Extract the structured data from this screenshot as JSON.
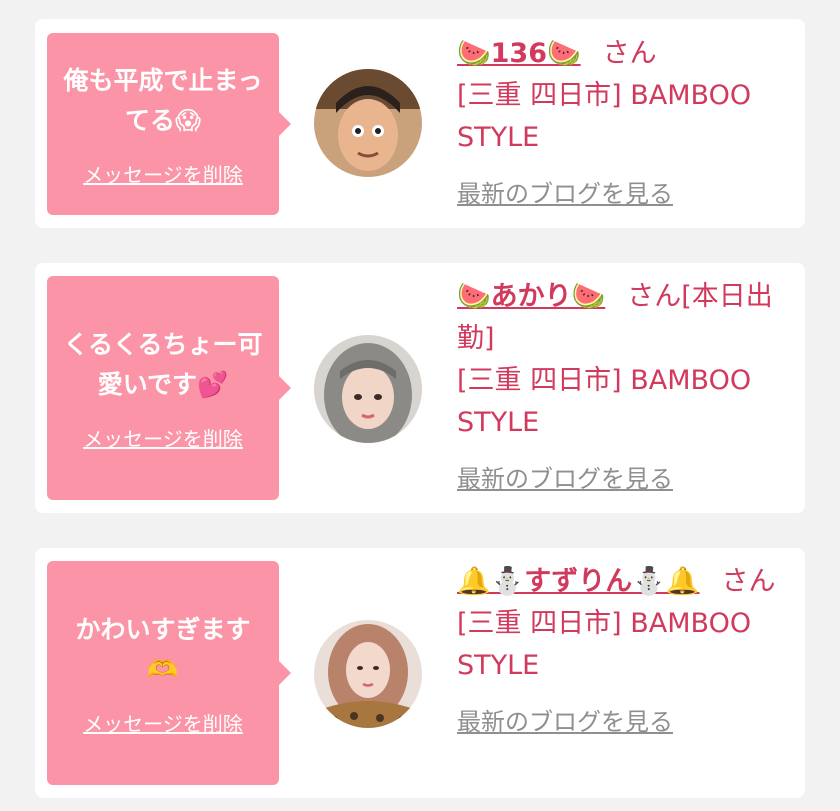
{
  "colors": {
    "background": "#f2f2f2",
    "card": "#ffffff",
    "bubble": "#fb94a6",
    "accent_text": "#d13a5c",
    "muted_link": "#8f8f8f"
  },
  "cards": [
    {
      "message": "俺も平成で止まってる😱",
      "delete_label": "メッセージを削除",
      "name": "🍉136🍉",
      "honorific": "さん",
      "shop": "[三重 四日市] BAMBOO STYLE",
      "blog_label": "最新のブログを見る",
      "avatar_icon": "user-avatar-photo"
    },
    {
      "message": "くるくるちょー可愛いです💕",
      "delete_label": "メッセージを削除",
      "name": "🍉あかり🍉",
      "honorific": "さん[本日出勤]",
      "shop": "[三重 四日市] BAMBOO STYLE",
      "blog_label": "最新のブログを見る",
      "avatar_icon": "user-avatar-photo"
    },
    {
      "message": "かわいすぎます🫶",
      "delete_label": "メッセージを削除",
      "name": "🔔⛄すずりん⛄🔔",
      "honorific": "さん",
      "shop": "[三重 四日市] BAMBOO STYLE",
      "blog_label": "最新のブログを見る",
      "avatar_icon": "user-avatar-photo"
    }
  ]
}
